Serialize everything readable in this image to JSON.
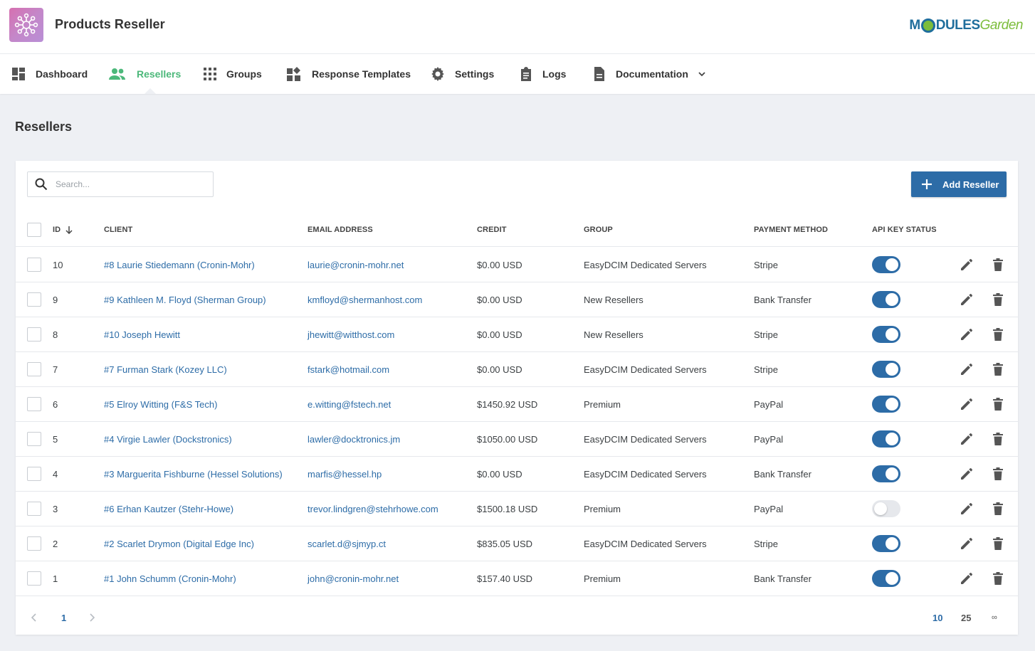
{
  "header": {
    "app_title": "Products Reseller",
    "brand_part1": "M",
    "brand_part2": "DULES",
    "brand_part3": "Garden"
  },
  "nav": {
    "items": [
      {
        "label": "Dashboard",
        "icon": "dashboard-icon"
      },
      {
        "label": "Resellers",
        "icon": "users-icon",
        "active": true
      },
      {
        "label": "Groups",
        "icon": "grid-icon"
      },
      {
        "label": "Response Templates",
        "icon": "widgets-icon"
      },
      {
        "label": "Settings",
        "icon": "gear-icon"
      },
      {
        "label": "Logs",
        "icon": "clipboard-icon"
      },
      {
        "label": "Documentation",
        "icon": "document-icon"
      }
    ]
  },
  "page": {
    "title": "Resellers"
  },
  "toolbar": {
    "search_placeholder": "Search...",
    "add_label": "Add Reseller"
  },
  "table": {
    "columns": [
      "ID",
      "CLIENT",
      "EMAIL ADDRESS",
      "CREDIT",
      "GROUP",
      "PAYMENT METHOD",
      "API KEY STATUS"
    ],
    "rows": [
      {
        "id": "10",
        "client": "#8 Laurie Stiedemann (Cronin-Mohr)",
        "email": "laurie@cronin-mohr.net",
        "credit": "$0.00 USD",
        "group": "EasyDCIM Dedicated Servers",
        "payment": "Stripe",
        "api_enabled": true
      },
      {
        "id": "9",
        "client": "#9 Kathleen M. Floyd (Sherman Group)",
        "email": "kmfloyd@shermanhost.com",
        "credit": "$0.00 USD",
        "group": "New Resellers",
        "payment": "Bank Transfer",
        "api_enabled": true
      },
      {
        "id": "8",
        "client": "#10 Joseph Hewitt",
        "email": "jhewitt@witthost.com",
        "credit": "$0.00 USD",
        "group": "New Resellers",
        "payment": "Stripe",
        "api_enabled": true
      },
      {
        "id": "7",
        "client": "#7 Furman Stark (Kozey LLC)",
        "email": "fstark@hotmail.com",
        "credit": "$0.00 USD",
        "group": "EasyDCIM Dedicated Servers",
        "payment": "Stripe",
        "api_enabled": true
      },
      {
        "id": "6",
        "client": "#5 Elroy Witting (F&S Tech)",
        "email": "e.witting@fstech.net",
        "credit": "$1450.92 USD",
        "group": "Premium",
        "payment": "PayPal",
        "api_enabled": true
      },
      {
        "id": "5",
        "client": "#4 Virgie Lawler (Dockstronics)",
        "email": "lawler@docktronics.jm",
        "credit": "$1050.00 USD",
        "group": "EasyDCIM Dedicated Servers",
        "payment": "PayPal",
        "api_enabled": true
      },
      {
        "id": "4",
        "client": "#3 Marguerita Fishburne (Hessel Solutions)",
        "email": "marfis@hessel.hp",
        "credit": "$0.00 USD",
        "group": "EasyDCIM Dedicated Servers",
        "payment": "Bank Transfer",
        "api_enabled": true
      },
      {
        "id": "3",
        "client": "#6 Erhan Kautzer (Stehr-Howe)",
        "email": "trevor.lindgren@stehrhowe.com",
        "credit": "$1500.18 USD",
        "group": "Premium",
        "payment": "PayPal",
        "api_enabled": false
      },
      {
        "id": "2",
        "client": "#2 Scarlet Drymon (Digital Edge Inc)",
        "email": "scarlet.d@sjmyp.ct",
        "credit": "$835.05 USD",
        "group": "EasyDCIM Dedicated Servers",
        "payment": "Stripe",
        "api_enabled": true
      },
      {
        "id": "1",
        "client": "#1 John Schumm (Cronin-Mohr)",
        "email": "john@cronin-mohr.net",
        "credit": "$157.40 USD",
        "group": "Premium",
        "payment": "Bank Transfer",
        "api_enabled": true
      }
    ]
  },
  "pagination": {
    "current_page": "1",
    "page_sizes": [
      "10",
      "25",
      "∞"
    ],
    "active_size": "10"
  },
  "colors": {
    "accent": "#2d6ca7",
    "nav_active": "#4cb87a",
    "background": "#eef0f4"
  }
}
